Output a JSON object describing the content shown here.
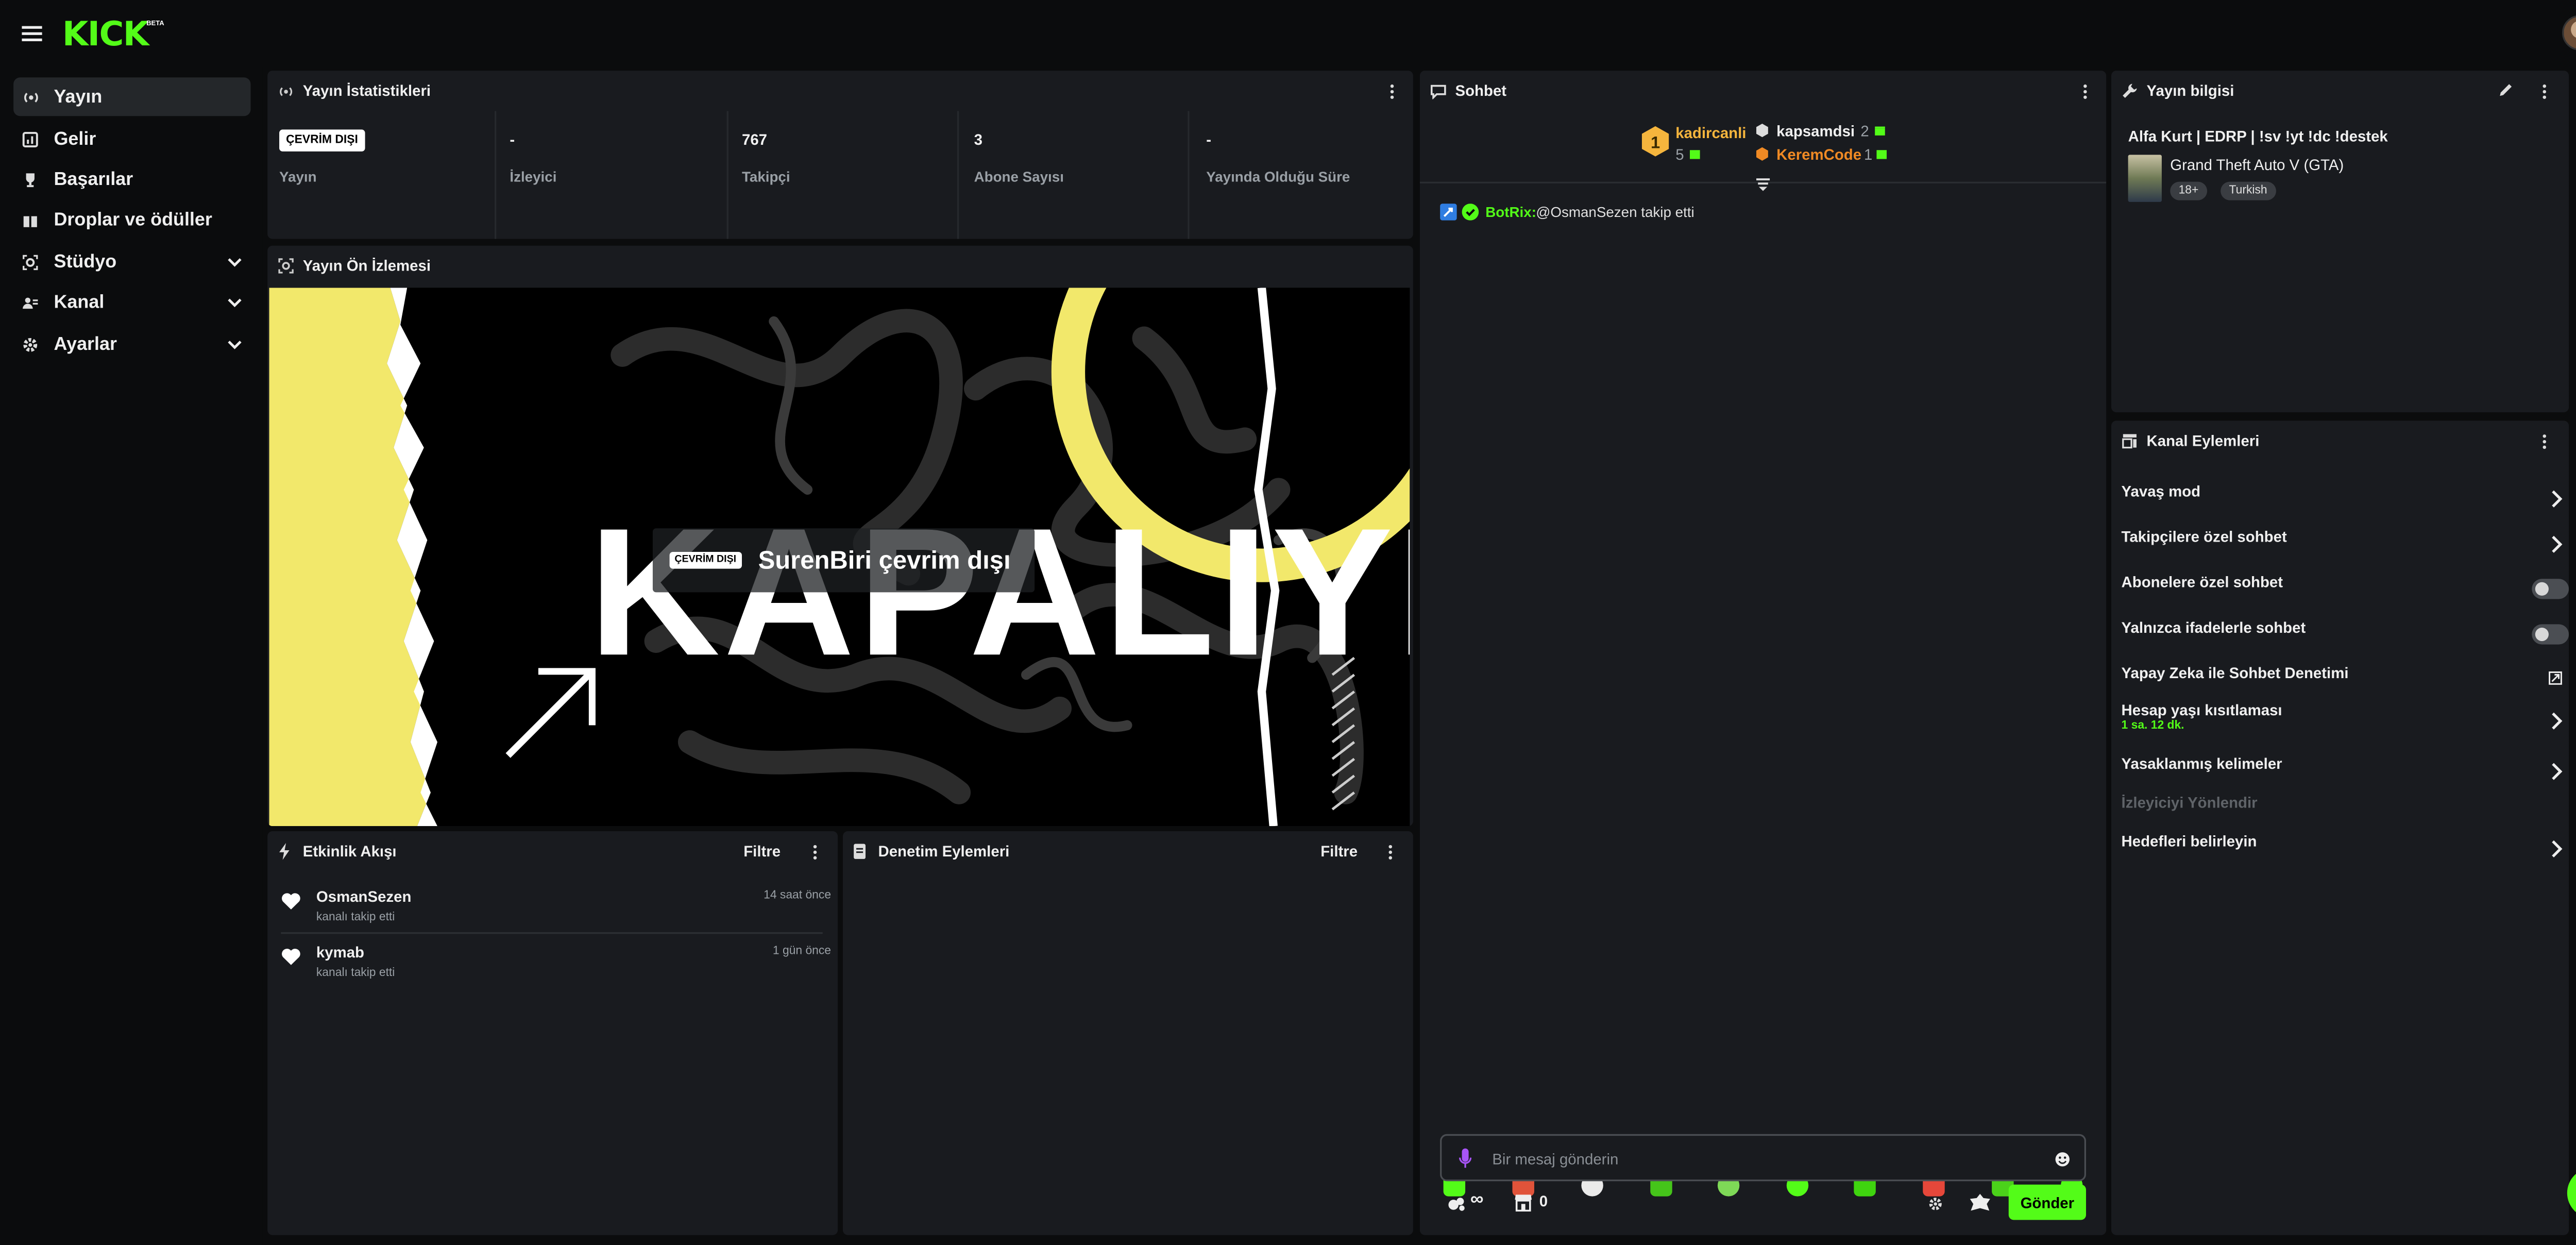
{
  "app": {
    "logo": "KICK",
    "logo_badge": "BETA"
  },
  "colors": {
    "accent": "#53fc18",
    "panel_bg": "#191b1f",
    "page_bg": "#0b0c0d",
    "gold": "#f5b53d",
    "orange": "#f08a24"
  },
  "sidebar": {
    "items": [
      {
        "label": "Yayın",
        "icon": "broadcast-icon",
        "active": true
      },
      {
        "label": "Gelir",
        "icon": "revenue-icon"
      },
      {
        "label": "Başarılar",
        "icon": "trophy-icon"
      },
      {
        "label": "Droplar ve ödüller",
        "icon": "gift-icon"
      },
      {
        "label": "Stüdyo",
        "icon": "studio-icon",
        "expandable": true
      },
      {
        "label": "Kanal",
        "icon": "channel-icon",
        "expandable": true
      },
      {
        "label": "Ayarlar",
        "icon": "gear-icon",
        "expandable": true
      }
    ]
  },
  "stats": {
    "title": "Yayın İstatistikleri",
    "items": [
      {
        "value": "ÇEVRİM DIŞI",
        "label": "Yayın"
      },
      {
        "value": "-",
        "label": "İzleyici"
      },
      {
        "value": "767",
        "label": "Takipçi"
      },
      {
        "value": "3",
        "label": "Abone Sayısı"
      },
      {
        "value": "-",
        "label": "Yayında Olduğu Süre"
      }
    ]
  },
  "preview": {
    "title": "Yayın Ön İzlemesi",
    "offline_badge": "ÇEVRİM DIŞI",
    "offline_text": "SurenBiri çevrim dışı",
    "image_text": "KAPALIYIZ"
  },
  "activity": {
    "title": "Etkinlik Akışı",
    "filter_label": "Filtre",
    "events": [
      {
        "name": "OsmanSezen",
        "action": "kanalı takip etti",
        "time": "14 saat önce"
      },
      {
        "name": "kymab",
        "action": "kanalı takip etti",
        "time": "1 gün önce"
      }
    ]
  },
  "moderation": {
    "title": "Denetim Eylemleri",
    "filter_label": "Filtre"
  },
  "chat": {
    "title": "Sohbet",
    "leaderboard": [
      {
        "rank": "1",
        "name": "kadircanli",
        "count": "5"
      },
      {
        "name": "kapsamdsi",
        "count": "2"
      },
      {
        "name": "KeremCode",
        "count": "1"
      }
    ],
    "messages": [
      {
        "user": "BotRix:",
        "text": "@OsmanSezen takip etti"
      }
    ],
    "input_placeholder": "Bir mesaj gönderin",
    "kick_points": "∞",
    "store_count": "0",
    "send_label": "Gönder"
  },
  "stream_info": {
    "title": "Yayın bilgisi",
    "stream_title": "Alfa Kurt | EDRP | !sv !yt !dc !destek",
    "category": "Grand Theft Auto V (GTA)",
    "tags": [
      "18+",
      "Turkish"
    ]
  },
  "channel_actions": {
    "title": "Kanal Eylemleri",
    "items": [
      {
        "label": "Yavaş mod",
        "control": "arrow"
      },
      {
        "label": "Takipçilere özel sohbet",
        "control": "arrow"
      },
      {
        "label": "Abonelere özel sohbet",
        "control": "toggle",
        "on": false
      },
      {
        "label": "Yalnızca ifadelerle sohbet",
        "control": "toggle",
        "on": false
      },
      {
        "label": "Yapay Zeka ile Sohbet Denetimi",
        "control": "external"
      },
      {
        "label": "Hesap yaşı kısıtlaması",
        "sub": "1 sa. 12 dk.",
        "control": "arrow"
      },
      {
        "label": "Yasaklanmış kelimeler",
        "control": "arrow"
      },
      {
        "label": "İzleyiciyi Yönlendir",
        "control": "none",
        "disabled": true
      },
      {
        "label": "Hedefleri belirleyin",
        "control": "arrow"
      }
    ]
  },
  "right_rail": {
    "icons": [
      "info-icon",
      "edit-icon",
      "screen-icon",
      "lightning-icon",
      "notes-icon",
      "chat-bubble-icon",
      "broadcast-icon",
      "video-icon",
      "wrench-icon",
      "kick-points-icon"
    ]
  },
  "support": {
    "icon": "headset-icon"
  }
}
